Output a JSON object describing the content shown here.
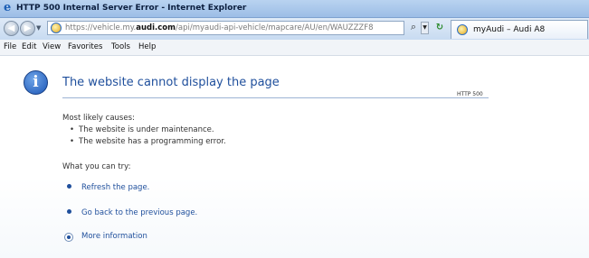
{
  "window": {
    "title": "HTTP 500 Internal Server Error - Internet Explorer"
  },
  "address_bar": {
    "url_prefix": "https://vehicle.my.",
    "url_domain": "audi.com",
    "url_path": "/api/myaudi-api-vehicle/mapcare/AU/en/WAUZZZF8"
  },
  "tab": {
    "label": "myAudi – Audi A8"
  },
  "menu": {
    "items": [
      "File",
      "Edit",
      "View",
      "Favorites",
      "Tools",
      "Help"
    ]
  },
  "error_page": {
    "heading": "The website cannot display the page",
    "code": "HTTP 500",
    "causes_label": "Most likely causes:",
    "causes": [
      "The website is under maintenance.",
      "The website has a programming error."
    ],
    "try_label": "What you can try:",
    "actions": [
      "Refresh the page.",
      "Go back to the previous page."
    ],
    "more_info": "More information"
  },
  "icons": {
    "app": "ie-logo-icon",
    "info": "info-icon",
    "back": "back-arrow-icon",
    "forward": "forward-arrow-icon",
    "search": "search-icon",
    "refresh": "refresh-icon"
  },
  "colors": {
    "titlebar": "#b9d3f0",
    "link": "#1f4f9c",
    "heading": "#1f4f9c"
  }
}
